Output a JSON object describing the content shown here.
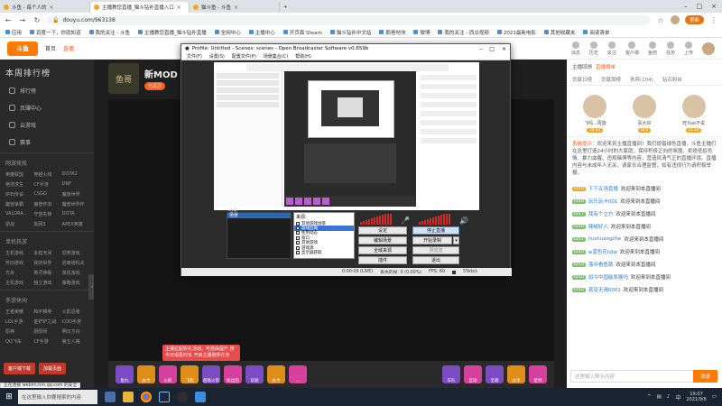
{
  "browser": {
    "tabs": [
      {
        "label": "斗鱼 - 毎个人的"
      },
      {
        "label": "主播教您直播_猫斗钻补直播入口",
        "active": true
      },
      {
        "label": "猫斗鱼 - 斗鱼"
      }
    ],
    "url": "douyu.com/963138",
    "update_label": "更新",
    "bookmarks": [
      "应用",
      "百度一下，你就知道",
      "我的关注 - 斗鱼",
      "主播教您直播_猫斗钻补直播",
      "全网中心",
      "主播中心",
      "开页面 Steam",
      "猫斗钻补中文站",
      "鹅爸地块",
      "微博",
      "我的关注 - 西瓜视频",
      "2021最新电影",
      "其他收藏夹",
      "阅读清单"
    ]
  },
  "douyu": {
    "logo": "斗鱼",
    "nav_items": [
      "首页",
      "直播"
    ],
    "right_icons": [
      "消息",
      "历史",
      "关注",
      "客户端",
      "鱼吧",
      "任务",
      "上传"
    ]
  },
  "sidebar": {
    "rank_title": "本周排行榜",
    "items": [
      "排行榜",
      "页赚中心",
      "云游戏",
      "赛事"
    ],
    "group1_title": "网游竞技",
    "group1": [
      "英雄联盟",
      "穿越火线",
      "DOTA2",
      "绝地求生",
      "CF手游",
      "DNF",
      "炉石传说",
      "CSGO",
      "魔兽世界",
      "魔兽争霸",
      "魔兽怀旧",
      "魔兽世界怀",
      "VALORA...",
      "守望先锋",
      "DOTA",
      "逆战",
      "剑网3",
      "APEX英雄"
    ],
    "group2_title": "单机热游",
    "group2": [
      "主机游戏",
      "永劫无间",
      "恐怖游戏",
      "怀旧游戏",
      "我的世界",
      "逃离塔科夫",
      "方舟",
      "英灵神殿",
      "单机游戏",
      "主机游戏",
      "独立游戏",
      "策略游戏"
    ],
    "group3_title": "手游休闲",
    "group3": [
      "王者荣耀",
      "和平精英",
      "火影忍者",
      "LOL手游",
      "金铲铲之战",
      "COD手游",
      "原神",
      "阴阳师",
      "明日方舟",
      "QQ飞车",
      "CF手游",
      "第五人格"
    ],
    "bottom_buttons": [
      "客户端下载",
      "加载页面"
    ]
  },
  "streamer": {
    "avatar_text": "鱼哥",
    "name": "新MOD",
    "tag": "已关注"
  },
  "gifts": [
    "鱼丸",
    "办卡",
    "火箭",
    "飞机",
    "超级火箭",
    "粉丝团",
    "穿越",
    "办卡",
    "...",
    "车队",
    "互动",
    "宝箱",
    "分享",
    "签到"
  ],
  "tooltip": "主播拉起收礼活动，可自由提升 按今日观看时长 开启主播陪伴任务",
  "obs": {
    "title": "Profile: Untitled - Scenes: scenes - Open Broadcaster Software v0.659b",
    "menu": [
      "文件(F)",
      "设置(S)",
      "配置文件(P)",
      "场景集合(C)",
      "帮助(H)"
    ],
    "scenes_header": "场景:",
    "scenes": [
      "场景"
    ],
    "sources_header": "来源:",
    "sources": [
      "其他游戏场景",
      "游戏区域",
      "使用动态",
      "窗口",
      "其他游戏",
      "游戏源",
      "显示器获取"
    ],
    "buttons": {
      "settings": "设定",
      "stop_stream": "停止直播",
      "edit_scene": "编辑场景",
      "start_record": "开始录制",
      "global_sources": "全域来源",
      "preview": "预览流",
      "plugins": "插件",
      "exit": "退出"
    },
    "status": {
      "time": "0:00:09 (LIVE)",
      "dropped": "丢失的帧: 0 (0.00%)",
      "fps": "FPS: 60",
      "bitrate": "55kb/s"
    }
  },
  "right_panel": {
    "tabs": [
      "主播回馈",
      "直播榜单"
    ],
    "subtabs": [
      "贡献日榜",
      "贡献周榜",
      "贵宾(104)",
      "钻石粉丝"
    ],
    "fans": [
      {
        "name": "飞吗...周旋",
        "lv": "LV.10"
      },
      {
        "name": "喜大好",
        "lv": "LV.8"
      },
      {
        "name": "旺Xuo不说",
        "lv": "LV.10"
      }
    ],
    "notice_label": "系统提示：",
    "notice": "欢迎来到主播直播间！我们提倡绿色直播，斗鱼主播们在这里打造24小时的大家庭，保持积极正向的氛围、拒绝低俗色情、暴力血腥、违规赌博等内容，营造风清气正的直播环境。直播内容与未成年人无关，请家长合理监督，如有违规行为请积极举报。",
    "chat": [
      {
        "lv": "LV10",
        "user": "下下五场直播",
        "msg": "欢迎来到本直播间"
      },
      {
        "lv": "LV10",
        "user": "玩乐玩卡001",
        "msg": "欢迎来到本直播间"
      },
      {
        "lv": "LV17",
        "user": "我有个立方",
        "msg": "欢迎来到本直播间"
      },
      {
        "lv": "LV10",
        "user": "辣椒好人",
        "msg": "欢迎来到本直播间"
      },
      {
        "lv": "LV17",
        "user": "liushuangzhe",
        "msg": "欢迎来到本直播间"
      },
      {
        "lv": "LV10",
        "user": "w蓝色花ldiw",
        "msg": "欢迎来到本直播间"
      },
      {
        "lv": "LV10",
        "user": "落中看鱼跳",
        "msg": "欢迎来到本直播间"
      },
      {
        "lv": "LV10",
        "user": "如今中国能发展吗",
        "msg": "欢迎来到本直播间"
      },
      {
        "lv": "LV10",
        "user": "真没无谓0001",
        "msg": "欢迎来到本直播间"
      }
    ],
    "chat_placeholder": "这里输入聊天内容",
    "send_label": "发送"
  },
  "browser_status": "正在连接 webim.tim.qq.com 的安全",
  "taskbar": {
    "search_placeholder": "在这里输入你要搜索的内容",
    "ime": "中",
    "time": "19:07",
    "date": "2021/9/6"
  }
}
